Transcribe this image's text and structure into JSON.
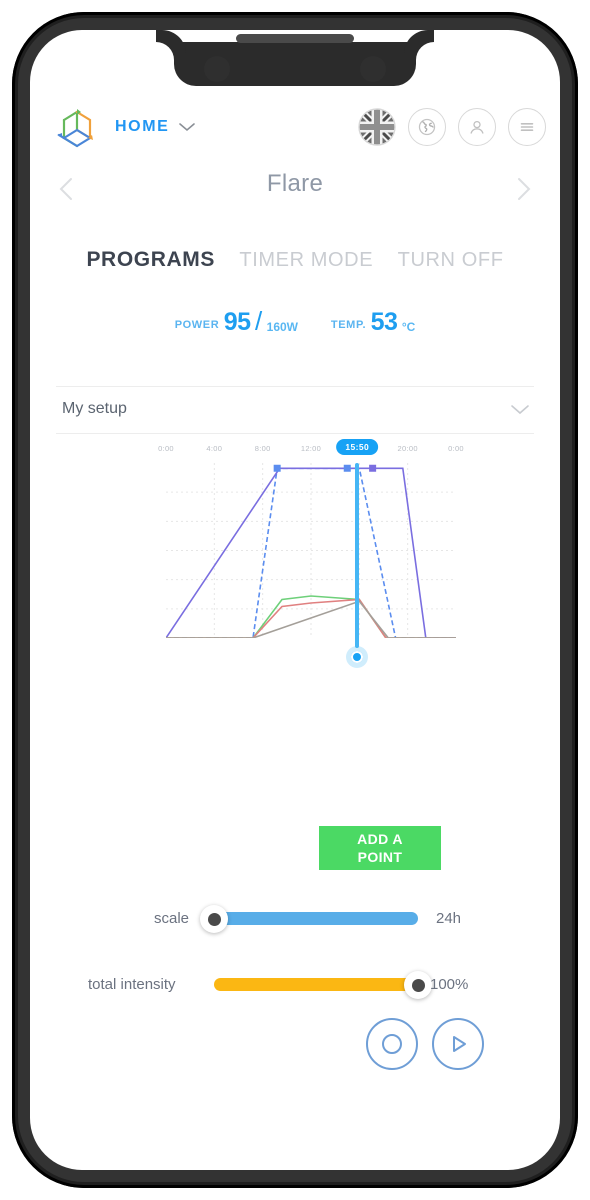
{
  "header": {
    "logo_icon": "cube-logo-icon",
    "home_label": "HOME",
    "home_caret_icon": "chevron-down-icon",
    "icons": [
      {
        "name": "uk-flag-icon",
        "label": "UK flag"
      },
      {
        "name": "globe-icon",
        "label": "Globe"
      },
      {
        "name": "user-icon",
        "label": "Account"
      },
      {
        "name": "hamburger-menu-icon",
        "label": "Menu"
      }
    ]
  },
  "title_row": {
    "prev_icon": "chevron-left-icon",
    "title": "Flare",
    "next_icon": "chevron-right-icon"
  },
  "tabs": [
    {
      "label": "PROGRAMS",
      "active": true
    },
    {
      "label": "TIMER MODE",
      "active": false
    },
    {
      "label": "TURN OFF",
      "active": false
    }
  ],
  "metrics": {
    "power_label": "POWER",
    "power_value": "95",
    "power_slash": "/",
    "power_max": "160W",
    "temp_label": "TEMP.",
    "temp_value": "53",
    "temp_unit": "°C"
  },
  "setup": {
    "label": "My setup",
    "caret_icon": "chevron-down-icon"
  },
  "chart_data": {
    "type": "line",
    "title": "",
    "xlabel": "",
    "ylabel": "",
    "x_tick_labels": [
      "0:00",
      "4:00",
      "8:00",
      "12:00",
      "20:00",
      "0:00"
    ],
    "cursor_time": "15:50",
    "grid": true,
    "legend": "none",
    "xlim": [
      0,
      24
    ],
    "ylim": [
      0,
      100
    ],
    "series": [
      {
        "name": "blue-channel",
        "color": "#5b8def",
        "style": "dashed",
        "points": [
          [
            0,
            0
          ],
          [
            7.2,
            0
          ],
          [
            9.2,
            97
          ],
          [
            16.0,
            97
          ],
          [
            19.0,
            0
          ],
          [
            24,
            0
          ]
        ]
      },
      {
        "name": "violet-channel",
        "color": "#7a6ee0",
        "style": "solid",
        "points": [
          [
            0,
            0
          ],
          [
            9.4,
            97
          ],
          [
            15.0,
            97
          ],
          [
            19.6,
            97
          ],
          [
            21.5,
            0
          ],
          [
            24,
            0
          ]
        ]
      },
      {
        "name": "green-channel",
        "color": "#6ed07a",
        "style": "solid",
        "points": [
          [
            0,
            0
          ],
          [
            7.2,
            0
          ],
          [
            9.6,
            22
          ],
          [
            12.0,
            24
          ],
          [
            16.0,
            22
          ],
          [
            18.2,
            0
          ],
          [
            24,
            0
          ]
        ]
      },
      {
        "name": "red-channel",
        "color": "#e08080",
        "style": "solid",
        "points": [
          [
            0,
            0
          ],
          [
            7.2,
            0
          ],
          [
            9.6,
            18
          ],
          [
            12.0,
            20
          ],
          [
            16.0,
            22
          ],
          [
            18.2,
            0
          ],
          [
            24,
            0
          ]
        ]
      },
      {
        "name": "white-channel",
        "color": "#a49f99",
        "style": "solid",
        "points": [
          [
            0,
            0
          ],
          [
            7.2,
            0
          ],
          [
            16.0,
            21
          ],
          [
            18.4,
            0
          ],
          [
            24,
            0
          ]
        ]
      }
    ],
    "point_markers": [
      {
        "x": 9.2,
        "y": 97,
        "color": "#5b8def"
      },
      {
        "x": 15.0,
        "y": 97,
        "color": "#5b8def"
      },
      {
        "x": 17.1,
        "y": 97,
        "color": "#7a6ee0"
      }
    ]
  },
  "add_point_button": {
    "line1": "ADD A",
    "line2": "POINT",
    "color": "#4bd964"
  },
  "sliders": [
    {
      "name": "scale",
      "label": "scale",
      "value_text": "24h",
      "fill_percent": 100,
      "knob_percent": 0,
      "color": "#58ade8"
    },
    {
      "name": "total-intensity",
      "label": "total intensity",
      "value_text": "100%",
      "fill_percent": 100,
      "knob_percent": 100,
      "color": "#fbb713"
    }
  ],
  "round_buttons": [
    {
      "name": "record-button",
      "icon": "circle-outline-icon"
    },
    {
      "name": "play-button",
      "icon": "play-icon"
    }
  ],
  "colors": {
    "accent_blue": "#2196f3",
    "cursor_blue": "#17a2f5",
    "green": "#4bd964",
    "amber": "#fbb713"
  }
}
